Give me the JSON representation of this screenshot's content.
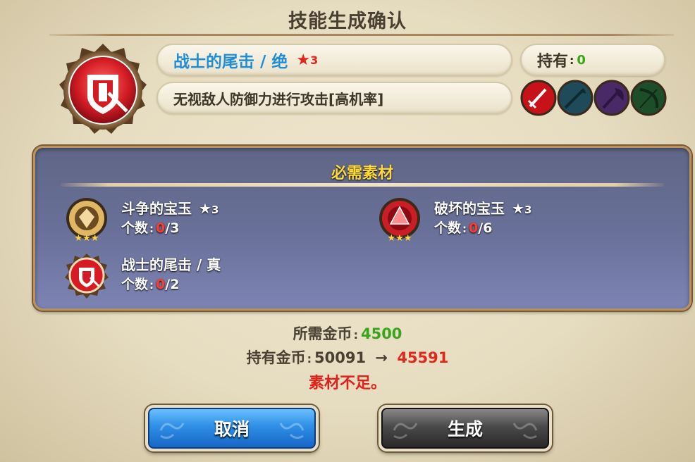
{
  "dialog": {
    "title": "技能生成确认"
  },
  "skill": {
    "name": "战士的尾击 / 绝",
    "star": "★",
    "rarity": "3",
    "owned_label": "持有",
    "owned_sep": ":",
    "owned_value": "0",
    "description": "无视敌人防御力进行攻击[高机率]",
    "class_icons": [
      "sword-class-icon",
      "spear-class-icon",
      "axe-class-icon",
      "bow-class-icon"
    ]
  },
  "materials": {
    "title": "必需素材",
    "count_label": "个数",
    "sep": ":",
    "items": [
      {
        "name": "斗争的宝玉",
        "star": "★",
        "rarity": "3",
        "have": "0",
        "need": "/3",
        "icon": "struggle-gem-icon"
      },
      {
        "name": "破坏的宝玉",
        "star": "★",
        "rarity": "3",
        "have": "0",
        "need": "/6",
        "icon": "destruction-gem-icon"
      },
      {
        "name": "战士的尾击 / 真",
        "have": "0",
        "need": "/2",
        "icon": "warrior-tail-strike-icon"
      }
    ]
  },
  "cost": {
    "required_label": "所需金币",
    "required_value": "4500",
    "owned_label": "持有金币",
    "sep": ":",
    "owned_current": "50091",
    "arrow": "→",
    "owned_after": "45591",
    "warning": "素材不足。"
  },
  "buttons": {
    "cancel": "取消",
    "create": "生成"
  },
  "colors": {
    "skill_name": "#1f8ed9",
    "star": "#e1261c",
    "owned_value": "#3aa51c",
    "panel_title": "#ffd93a",
    "cost_required": "#3aa51c",
    "warning": "#e0211a"
  }
}
